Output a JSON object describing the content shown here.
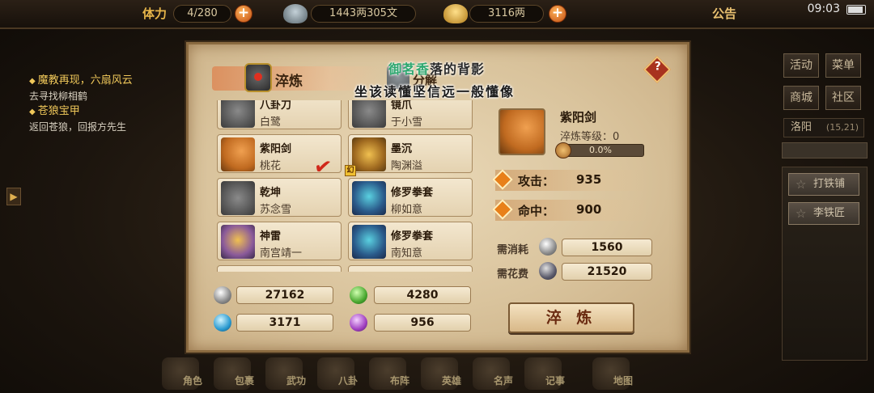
{
  "topbar": {
    "stamina_label": "体力",
    "stamina_value": "4/280",
    "copper_value": "1443两305文",
    "gold_value": "3116两",
    "announcement": "公告",
    "time": "09:03"
  },
  "quests": [
    {
      "title": "魔教再现，六扇风云",
      "desc": "去寻找柳相鹤"
    },
    {
      "title": "苍狼宝甲",
      "desc": "返回苍狼，回报方先生"
    }
  ],
  "right_menu": {
    "buttons": [
      "活动",
      "菜单",
      "商城",
      "社区"
    ],
    "location": "洛阳",
    "coords": "(15,21)",
    "npcs": [
      "打铁铺",
      "李铁匠"
    ]
  },
  "bottom_menu": [
    "角色",
    "包裹",
    "武功",
    "八卦",
    "布阵",
    "英雄",
    "名声",
    "记事",
    "地图"
  ],
  "dialog": {
    "tab_active": "淬炼",
    "tab_other": "分解",
    "overlay_line1_green": "御茗香",
    "overlay_line1_dark": "落的背影",
    "overlay_line2": "坐该读懂坚信远一般懂像",
    "help": "?",
    "items": [
      {
        "name": "八卦刀",
        "owner": "白鹭",
        "type": "blade"
      },
      {
        "name": "镜爪",
        "owner": "于小雪",
        "type": "blade"
      },
      {
        "name": "紫阳剑",
        "owner": "桃花",
        "type": "sword"
      },
      {
        "name": "墨沉",
        "owner": "陶渊溢",
        "type": "hook"
      },
      {
        "name": "乾坤",
        "owner": "苏念雪",
        "type": "blade"
      },
      {
        "name": "修罗拳套",
        "owner": "柳如意",
        "type": "armor-blue"
      },
      {
        "name": "神雷",
        "owner": "南宫靖一",
        "type": "armor-gold"
      },
      {
        "name": "修罗拳套",
        "owner": "南知意",
        "type": "armor-blue"
      }
    ],
    "huan_badge": "幻",
    "materials": [
      {
        "icon": "silver-ore-icon",
        "value": "27162"
      },
      {
        "icon": "green-ore-icon",
        "value": "4280"
      },
      {
        "icon": "blue-ore-icon",
        "value": "3171"
      },
      {
        "icon": "purple-ore-icon",
        "value": "956"
      }
    ],
    "detail": {
      "name": "紫阳剑",
      "level": "淬炼等级：0",
      "progress_text": "0.0%",
      "progress": 0.0,
      "attack_label": "攻击：",
      "attack_value": "935",
      "hit_label": "命中：",
      "hit_value": "900",
      "need_consume_label": "需消耗",
      "need_consume_value": "1560",
      "need_cost_label": "需花费",
      "need_cost_value": "21520"
    },
    "smelt_button": "淬 炼"
  },
  "colors": {
    "parchment": "#e4d2b0",
    "accent_orange": "#e8801a",
    "gold": "#e8b64a",
    "check_red": "#d0281a"
  }
}
